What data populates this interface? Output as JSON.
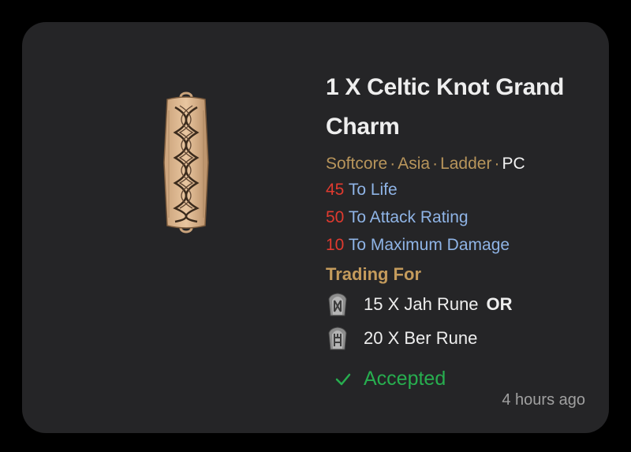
{
  "listing": {
    "title": "1 X Celtic Knot Grand Charm",
    "image_icon": "grand-charm-icon",
    "meta": {
      "mode": "Softcore",
      "region": "Asia",
      "ladder": "Ladder",
      "platform": "PC",
      "separator": "·"
    },
    "stats": [
      {
        "value": "45",
        "label": "To Life"
      },
      {
        "value": "50",
        "label": "To Attack Rating"
      },
      {
        "value": "10",
        "label": "To Maximum Damage"
      }
    ],
    "trading_label": "Trading For",
    "wants": [
      {
        "text": "15 X Jah Rune",
        "connector": "OR",
        "icon": "jah-rune-icon"
      },
      {
        "text": "20 X Ber Rune",
        "connector": "",
        "icon": "ber-rune-icon"
      }
    ],
    "status": "Accepted",
    "timestamp": "4 hours ago"
  },
  "colors": {
    "background": "#000000",
    "card": "#252527",
    "title": "#eeeeee",
    "meta": "#b8955b",
    "stat_value": "#e03a2f",
    "stat_label": "#8fb4e6",
    "trading_label": "#c49b5c",
    "status": "#27ae4f",
    "timestamp": "#a0a0a0"
  }
}
